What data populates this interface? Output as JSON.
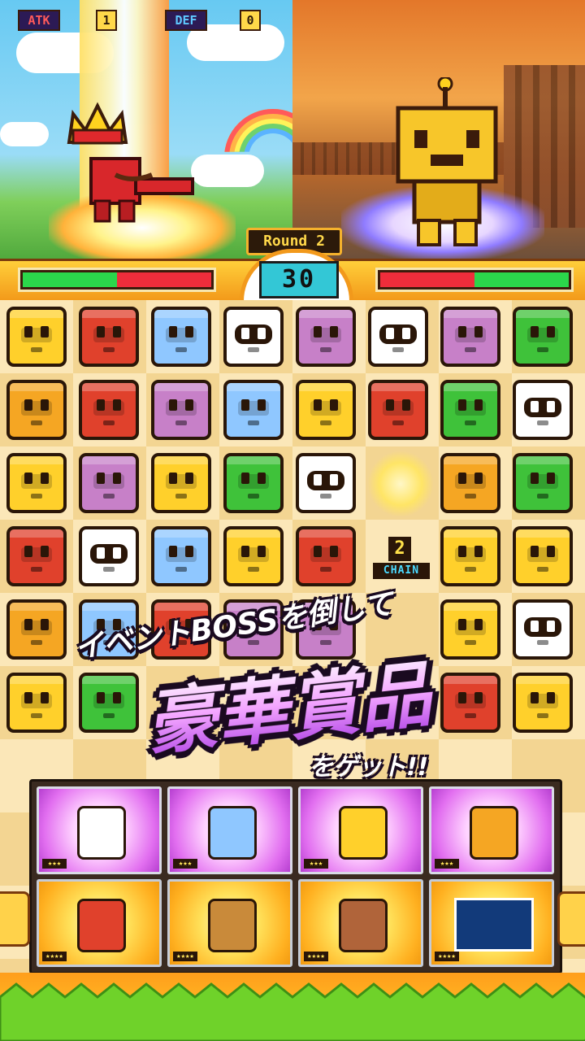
{
  "stats": {
    "atk_label": "ATK",
    "atk_value": "1",
    "def_label": "DEF",
    "def_value": "0"
  },
  "round": {
    "label": "Round 2",
    "timer": "30"
  },
  "health": {
    "player_fraction": 0.5,
    "enemy_fraction": 0.5,
    "hp_color": "#2bd64b",
    "damage_color": "#ef2d3b"
  },
  "characters": {
    "player": "red-king-fighter",
    "enemy": "gold-robot-boss"
  },
  "board": {
    "rows": [
      [
        "giraffe",
        "monkey",
        "ghost",
        "panda",
        "hippo",
        "panda",
        "hippo",
        "frog"
      ],
      [
        "lion",
        "monkey",
        "hippo",
        "ghost",
        "giraffe",
        "monkey",
        "frog",
        "panda"
      ],
      [
        "giraffe",
        "hippo",
        "giraffe",
        "frog",
        "panda",
        "empty",
        "lion",
        "frog"
      ],
      [
        "monkey",
        "panda",
        "ghost",
        "giraffe",
        "monkey",
        "empty",
        "giraffe",
        "giraffe"
      ],
      [
        "lion",
        "ghost",
        "monkey",
        "hippo",
        "hippo",
        "empty",
        "giraffe",
        "panda"
      ],
      [
        "giraffe",
        "frog",
        "empty",
        "empty",
        "empty",
        "empty",
        "monkey",
        "giraffe"
      ]
    ],
    "chain_count": "2",
    "chain_label": "CHAIN"
  },
  "promo": {
    "line1": "イベントBOSSを倒して",
    "main": "豪華賞品",
    "sub": "をゲット!!"
  },
  "prizes": [
    {
      "character": "panda-flower",
      "tier": "pink",
      "rank": "★★★"
    },
    {
      "character": "ghost-blue",
      "tier": "pink",
      "rank": "★★★"
    },
    {
      "character": "giraffe-gold",
      "tier": "pink",
      "rank": "★★★"
    },
    {
      "character": "lion-flower",
      "tier": "pink",
      "rank": "★★★"
    },
    {
      "character": "monkey-red",
      "tier": "gold",
      "rank": "★★★★"
    },
    {
      "character": "reindeer",
      "tier": "gold",
      "rank": "★★★★"
    },
    {
      "character": "candy-house",
      "tier": "gold",
      "rank": "★★★★"
    },
    {
      "character": "snow-scene",
      "tier": "gold",
      "rank": "★★★★"
    }
  ],
  "colors": {
    "hud_gold": "#ffcf3a",
    "timer_bg": "#33c7d6",
    "promo_purple": "#a12fe0"
  }
}
